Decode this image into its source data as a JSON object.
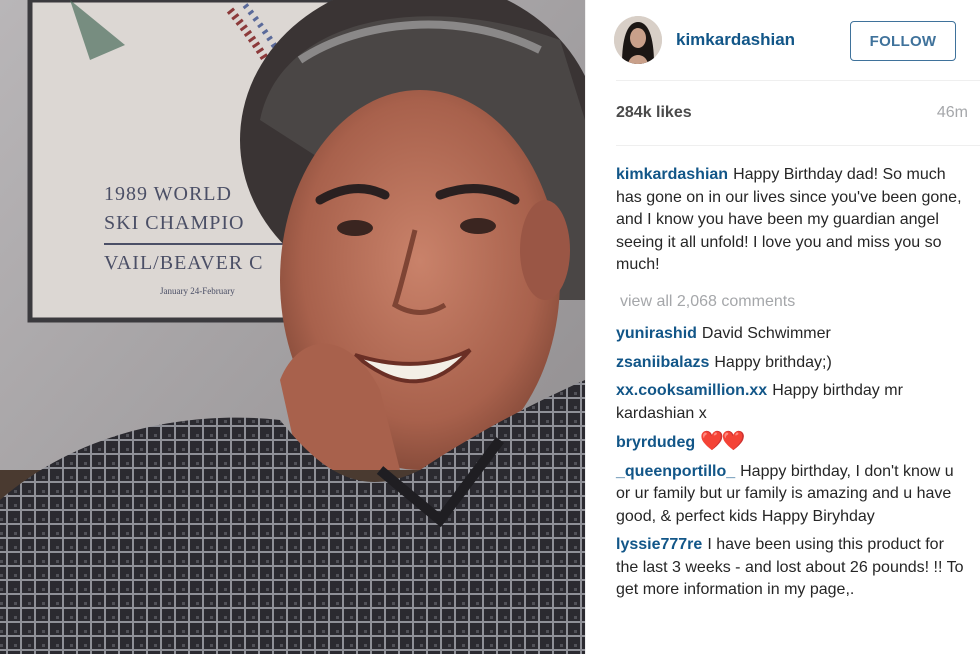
{
  "post": {
    "username": "kimkardashian",
    "follow_label": "FOLLOW",
    "likes": "284k likes",
    "time": "46m"
  },
  "photo": {
    "poster_line1": "1989 WORLD",
    "poster_line2": "SKI CHAMPIO",
    "poster_line3": "VAIL/BEAVER C",
    "poster_line4": "January 24-February"
  },
  "caption": {
    "user": "kimkardashian",
    "text": "Happy Birthday dad! So much has gone on in our lives since you've been gone, and I know you have been my guardian angel seeing it all unfold! I love you and miss you so much!"
  },
  "view_all": "view all 2,068 comments",
  "comments": [
    {
      "user": "yunirashid",
      "text": "David Schwimmer"
    },
    {
      "user": "zsaniibalazs",
      "text": "Happy brithday;)"
    },
    {
      "user": "xx.cooksamillion.xx",
      "text": "Happy birthday mr kardashian x"
    },
    {
      "user": "bryrdudeg",
      "text": "❤️❤️"
    },
    {
      "user": "_queenportillo_",
      "text": "Happy birthday, I don't know u or ur family but ur family is amazing and u have good, & perfect kids Happy Biryhday"
    },
    {
      "user": "lyssie777re",
      "text": "I have been using this product for the last 3 weeks - and lost about 26 pounds! !! To get more information in my page,."
    }
  ],
  "colors": {
    "username_blue": "#125688",
    "follow_blue": "#3f729b",
    "muted_gray": "#a5a7aa"
  }
}
